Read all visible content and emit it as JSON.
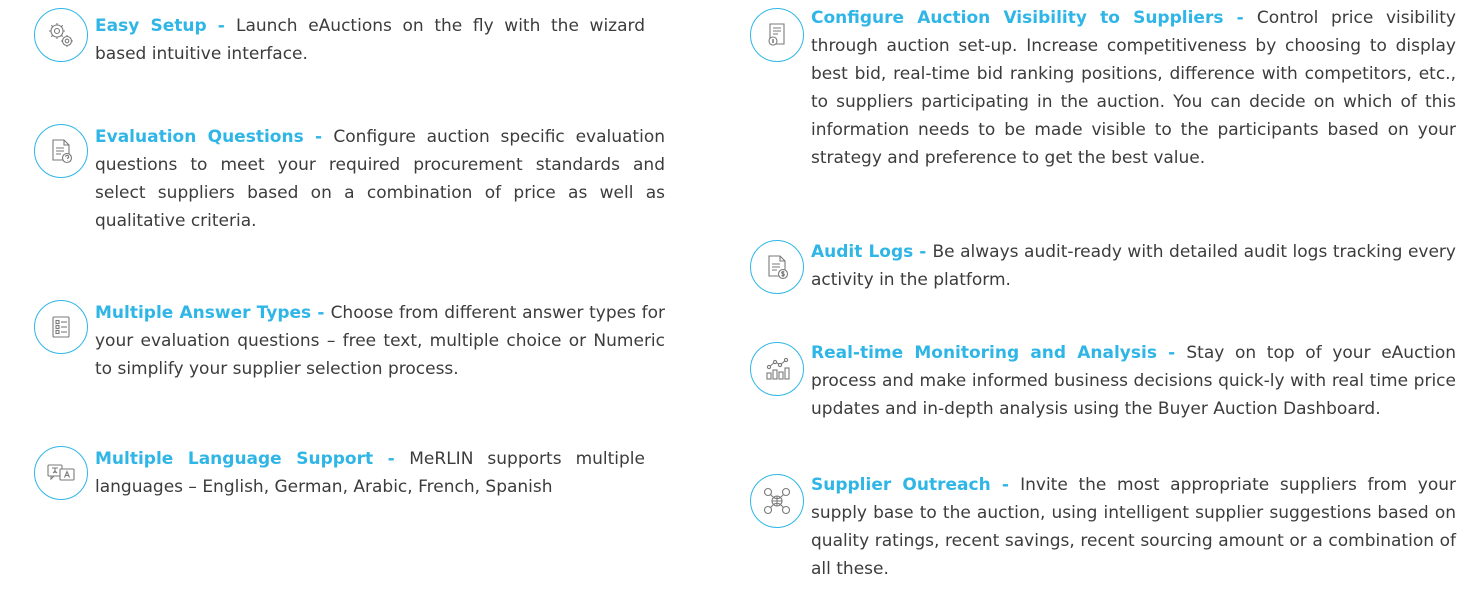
{
  "accent_color": "#2fb6e6",
  "text_color": "#3c3c3c",
  "separator": " - ",
  "left_features": [
    {
      "icon": "gears-icon",
      "title": "Easy Setup",
      "description": "Launch eAuctions on the fly with the wizard based intuitive interface."
    },
    {
      "icon": "document-question-icon",
      "title": "Evaluation Questions",
      "description": "Configure auction specific evaluation questions to meet your required procurement standards and select suppliers based on a combination of price as well as qualitative criteria."
    },
    {
      "icon": "checklist-icon",
      "title": "Multiple Answer Types",
      "description": "Choose from different answer types for your evaluation questions – free text, multiple choice or Numeric to simplify your supplier selection process."
    },
    {
      "icon": "translate-icon",
      "title": "Multiple Language Support",
      "description": "MeRLIN supports multiple languages – English, German, Arabic, French, Spanish"
    }
  ],
  "right_features": [
    {
      "icon": "document-price-icon",
      "title": "Configure Auction Visibility to Suppliers",
      "description": "Control price visibility through auction set-up. Increase competitiveness by choosing to display best bid, real-time bid ranking positions, difference with competitors, etc., to suppliers participating in the auction. You can decide on which of this information needs to be made visible to the participants based on your strategy and preference to get the best value."
    },
    {
      "icon": "document-dollar-icon",
      "title": "Audit Logs",
      "description": "Be always audit-ready with detailed audit logs tracking every activity in the platform."
    },
    {
      "icon": "analytics-chart-icon",
      "title": "Real-time Monitoring and Analysis",
      "description": "Stay on top of your eAuction process and make informed business decisions quick-ly with real time price updates and in-depth analysis using the Buyer Auction Dashboard."
    },
    {
      "icon": "supplier-network-icon",
      "title": "Supplier Outreach",
      "description": "Invite the most appropriate suppliers from your supply base to the auction, using intelligent supplier suggestions based on quality ratings, recent savings, recent sourcing amount or a combination of all these."
    }
  ]
}
